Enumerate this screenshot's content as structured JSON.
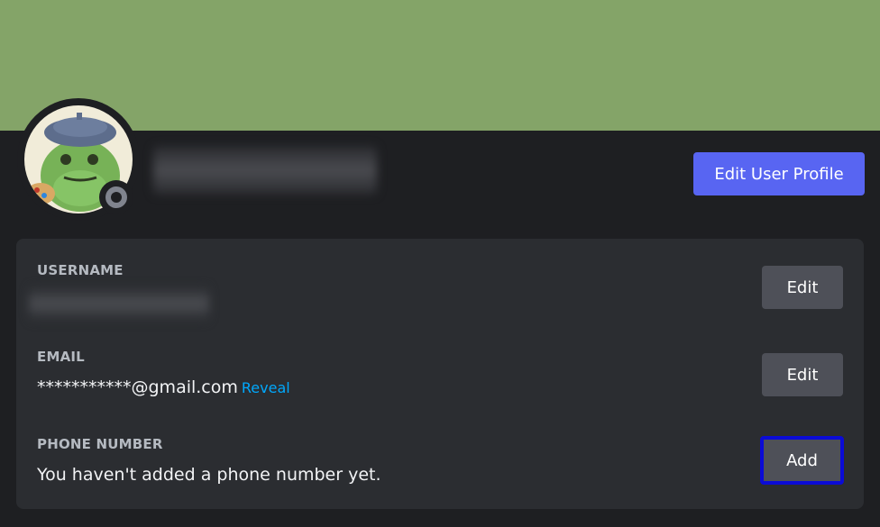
{
  "profile": {
    "edit_profile_label": "Edit User Profile",
    "status": "offline"
  },
  "account": {
    "username_label": "USERNAME",
    "username_edit": "Edit",
    "email_label": "EMAIL",
    "email_value": "***********@gmail.com",
    "email_reveal": "Reveal",
    "email_edit": "Edit",
    "phone_label": "PHONE NUMBER",
    "phone_value": "You haven't added a phone number yet.",
    "phone_add": "Add"
  },
  "colors": {
    "banner": "#84a468",
    "accent": "#5865f2",
    "link": "#00a8fc",
    "focus_outline": "#0b0bd6"
  }
}
